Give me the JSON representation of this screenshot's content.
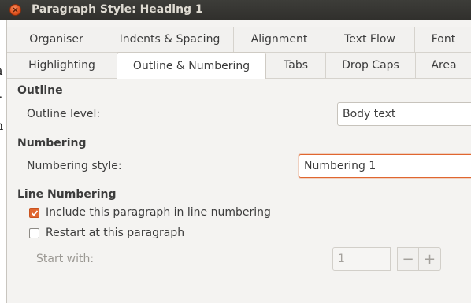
{
  "window": {
    "title": "Paragraph Style: Heading 1"
  },
  "tabs_row1": [
    {
      "label": "Organiser",
      "active": false
    },
    {
      "label": "Indents & Spacing",
      "active": false
    },
    {
      "label": "Alignment",
      "active": false
    },
    {
      "label": "Text Flow",
      "active": false
    },
    {
      "label": "Font",
      "active": false
    }
  ],
  "tabs_row2": [
    {
      "label": "Highlighting",
      "active": false
    },
    {
      "label": "Outline & Numbering",
      "active": true
    },
    {
      "label": "Tabs",
      "active": false
    },
    {
      "label": "Drop Caps",
      "active": false
    },
    {
      "label": "Area",
      "active": false
    }
  ],
  "outline": {
    "section_title": "Outline",
    "level_label": "Outline level:",
    "level_value": "Body text"
  },
  "numbering": {
    "section_title": "Numbering",
    "style_label": "Numbering style:",
    "style_value": "Numbering 1"
  },
  "line_numbering": {
    "section_title": "Line Numbering",
    "include_label": "Include this paragraph in line numbering",
    "include_checked": true,
    "restart_label": "Restart at this paragraph",
    "restart_checked": false,
    "start_with_label": "Start with:",
    "start_with_value": "1",
    "minus_symbol": "−",
    "plus_symbol": "+"
  },
  "colors": {
    "accent": "#e0662f",
    "titlebar": "#3d3d39"
  }
}
